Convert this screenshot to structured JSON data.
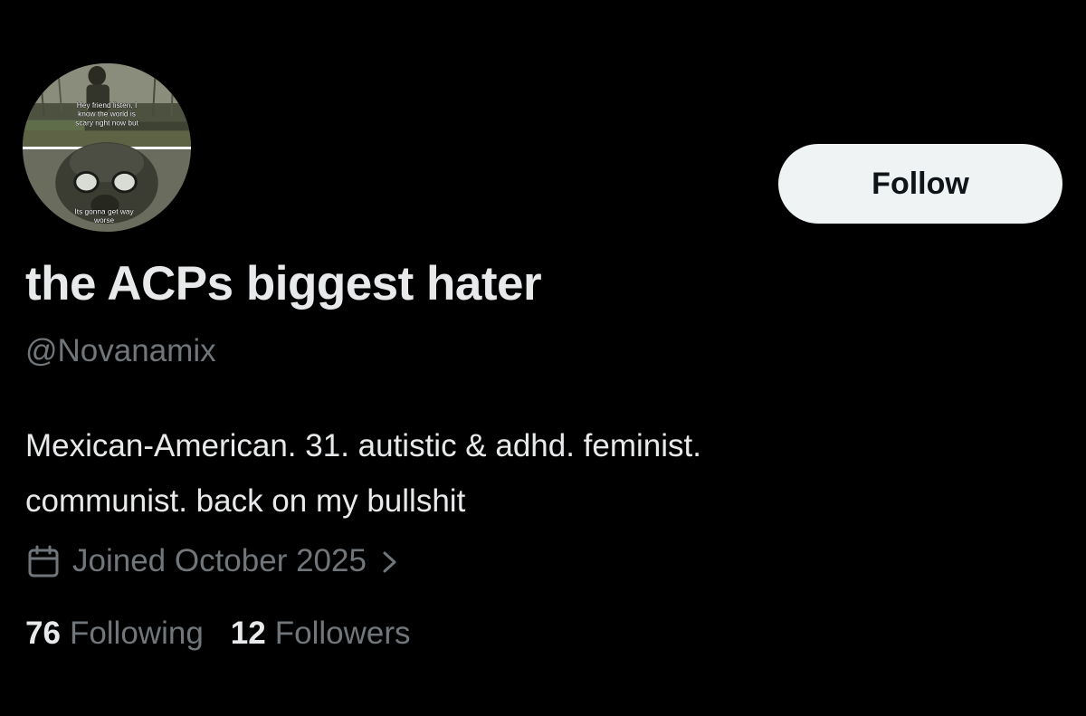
{
  "avatar": {
    "caption_top": [
      "Hey friend listen, I",
      "know the world is",
      "scary right now but"
    ],
    "caption_bottom": [
      "Its gonna get way",
      "worse"
    ]
  },
  "follow_button": {
    "label": "Follow"
  },
  "profile": {
    "display_name": "the ACPs biggest hater",
    "handle": "@Novanamix",
    "bio_lines": [
      "Mexican-American. 31. autistic & adhd. feminist.",
      "communist. back on my bullshit"
    ],
    "joined": "Joined October 2025",
    "joined_icon": "calendar-icon",
    "joined_chevron": "chevron-right-icon"
  },
  "stats": {
    "following_count": "76",
    "following_label": "Following",
    "followers_count": "12",
    "followers_label": "Followers"
  },
  "colors": {
    "background": "#000000",
    "primary_text": "#e7e9ea",
    "secondary_text": "#71767b",
    "button_bg": "#eff3f4",
    "button_text": "#0f1419"
  }
}
